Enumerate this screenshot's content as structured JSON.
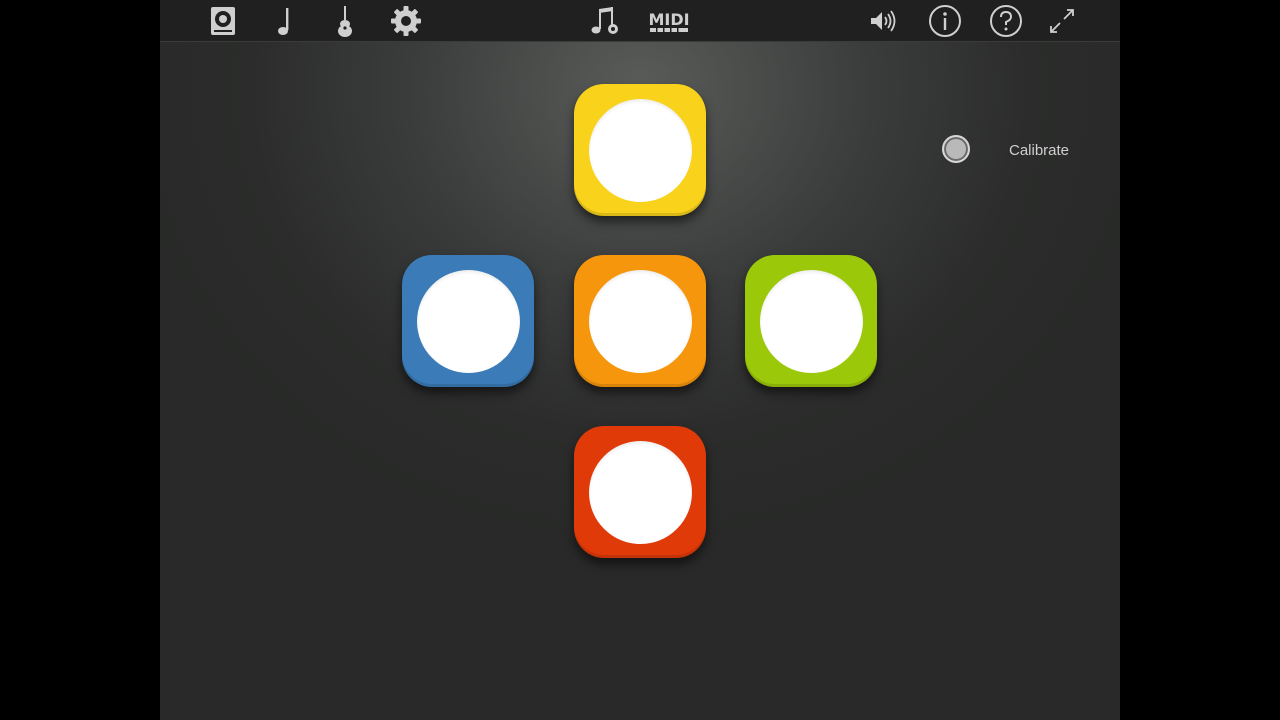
{
  "toolbar": {
    "left_icons": [
      "amp-icon",
      "music-note-icon",
      "guitar-icon",
      "gear-icon"
    ],
    "center_icons": [
      "song-icon",
      "midi-icon"
    ],
    "midi_label": "MIDI",
    "right_icons": [
      "speaker-icon",
      "info-icon",
      "help-icon",
      "fullscreen-icon"
    ],
    "icon_color": "#cfcfcf"
  },
  "pads": [
    {
      "name": "yellow",
      "color": "#f9d21b"
    },
    {
      "name": "blue",
      "color": "#3a7bb8"
    },
    {
      "name": "orange",
      "color": "#f6960c"
    },
    {
      "name": "green",
      "color": "#9cc80a"
    },
    {
      "name": "red",
      "color": "#e03a09"
    }
  ],
  "calibrate": {
    "label": "Calibrate"
  }
}
